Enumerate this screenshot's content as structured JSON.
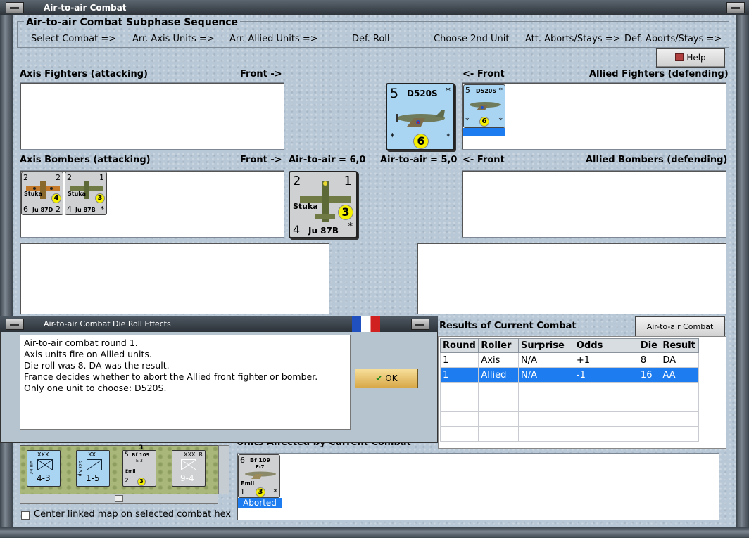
{
  "window": {
    "title": "Air-to-air Combat"
  },
  "sequence": {
    "title": "Air-to-air Combat Subphase Sequence",
    "steps": [
      "Select Combat =>",
      "Arr. Axis Units =>",
      "Arr. Allied Units =>",
      "Def. Roll",
      "Choose 2nd Unit",
      "Att. Aborts/Stays =>",
      "Def. Aborts/Stays =>"
    ]
  },
  "help_label": "Help",
  "labels": {
    "axis_fighters": "Axis Fighters (attacking)",
    "front_right": "Front ->",
    "front_left": "<- Front",
    "allied_fighters": "Allied Fighters (defending)",
    "axis_bombers": "Axis Bombers (attacking)",
    "allied_bombers": "Allied Bombers (defending)",
    "axis_a2a": "Air-to-air = 6,0",
    "allied_a2a": "Air-to-air = 5,0"
  },
  "units": {
    "d520s_big": {
      "attack": "5",
      "name": "D520S",
      "star": "*",
      "range": "6"
    },
    "d520s_small": {
      "attack": "5",
      "name": "D520S",
      "star": "*",
      "range": "6"
    },
    "stuka_big": {
      "top_left": "2",
      "top_right": "1",
      "label": "Stuka",
      "range": "3",
      "bottom_left": "4",
      "name": "Ju 87B",
      "star": "*"
    },
    "ju87d": {
      "top_left": "2",
      "top_right": "2",
      "label": "Stuka",
      "range": "4",
      "bottom_left": "6",
      "name": "Ju 87D",
      "bottom_right": "2"
    },
    "ju87b_small": {
      "top_left": "2",
      "top_right": "1",
      "label": "Stuka",
      "range": "3",
      "bottom_left": "4",
      "name": "Ju 87B",
      "star": "*"
    },
    "bf109": {
      "top_left": "6",
      "name": "Bf 109",
      "variant": "E-7",
      "label": "Emil",
      "bottom_left": "1",
      "range": "3",
      "star": "*",
      "status": "Aborted"
    }
  },
  "dialog": {
    "title": "Air-to-air Combat Die Roll Effects",
    "lines": [
      "Air-to-air combat round 1.",
      "Axis units fire on Allied units.",
      "Die roll was 8.  DA was the result.",
      "France decides whether to abort the Allied front fighter or bomber.",
      "Only one unit to choose: D520S."
    ],
    "ok_label": "OK"
  },
  "results": {
    "title": "Results of Current Combat",
    "chart_button": "Air-to-air Combat Chart",
    "columns": [
      "Round",
      "Roller",
      "Surprise",
      "Odds",
      "Die",
      "Result"
    ],
    "rows": [
      [
        "1",
        "Axis",
        "N/A",
        "+1",
        "8",
        "DA"
      ],
      [
        "1",
        "Allied",
        "N/A",
        "-1",
        "16",
        "AA"
      ]
    ]
  },
  "affected_title": "Units Affected by Current Combat",
  "map_counters": [
    {
      "size": "XXX",
      "side": "VIII Inf",
      "value": "4-3"
    },
    {
      "size": "XX",
      "side": "Ger Alp",
      "value": "1-5"
    },
    {
      "top_left": "5",
      "name": "Bf 109",
      "variant": "E-3",
      "label": "Emil",
      "bottom_left": "2",
      "range": "3"
    },
    {
      "size": "XXX",
      "value": "9-4",
      "corner": "R"
    }
  ],
  "map_hint": "3",
  "checkbox_label": "Center linked map on selected combat hex",
  "colors": {
    "selection": "#1c7cf0",
    "french_counter": "#a9d4f2",
    "axis_counter": "#cfd0d2",
    "dot": "#f4f000"
  }
}
